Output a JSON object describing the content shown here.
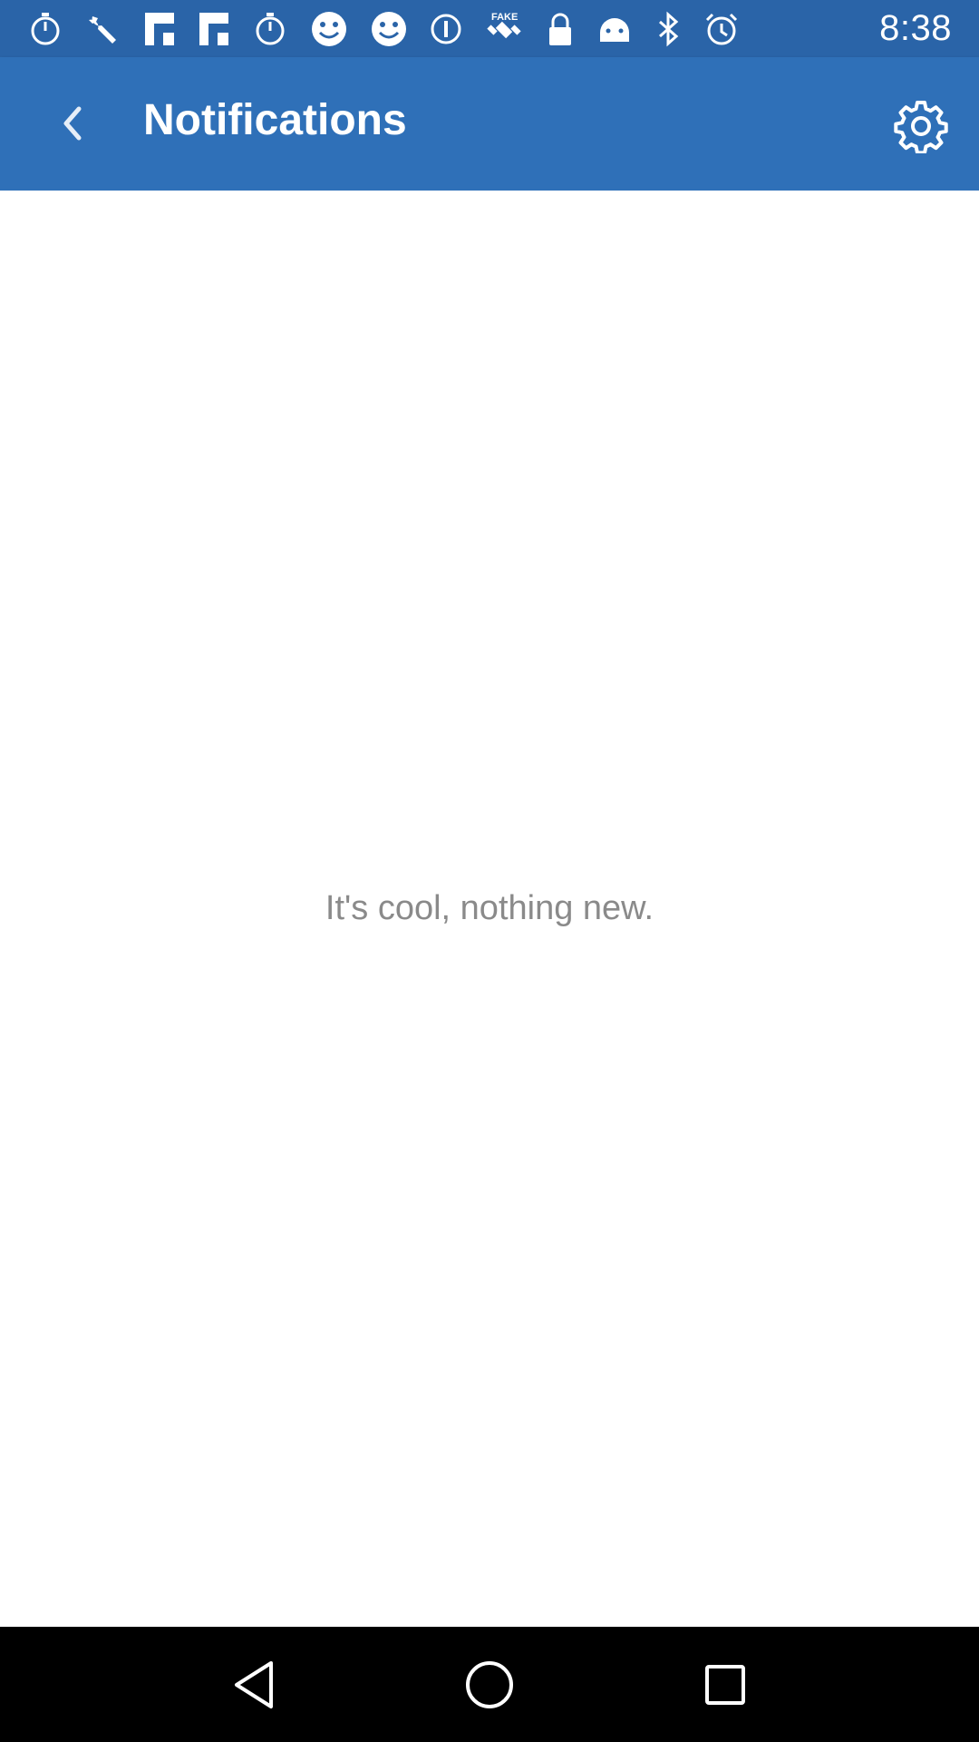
{
  "status_bar": {
    "time": "8:38",
    "icons": [
      "stopwatch-icon",
      "wrench-icon",
      "flipboard-icon",
      "flipboard-icon",
      "stopwatch-icon",
      "smiley-icon",
      "smiley-icon",
      "info-icon",
      "fake-gps-icon",
      "lock-icon",
      "android-icon",
      "bluetooth-icon",
      "alarm-icon"
    ],
    "fake_label": "FAKE"
  },
  "app_bar": {
    "title": "Notifications",
    "back_icon": "chevron-left-icon",
    "settings_icon": "gear-icon"
  },
  "content": {
    "empty_message": "It's cool, nothing new."
  },
  "nav_bar": {
    "buttons": [
      "back-triangle-icon",
      "home-circle-icon",
      "recents-square-icon"
    ]
  },
  "colors": {
    "status_bar": "#2a64a8",
    "app_bar": "#2f70b8",
    "text_muted": "#8a8a8a",
    "nav_bar": "#000000"
  }
}
